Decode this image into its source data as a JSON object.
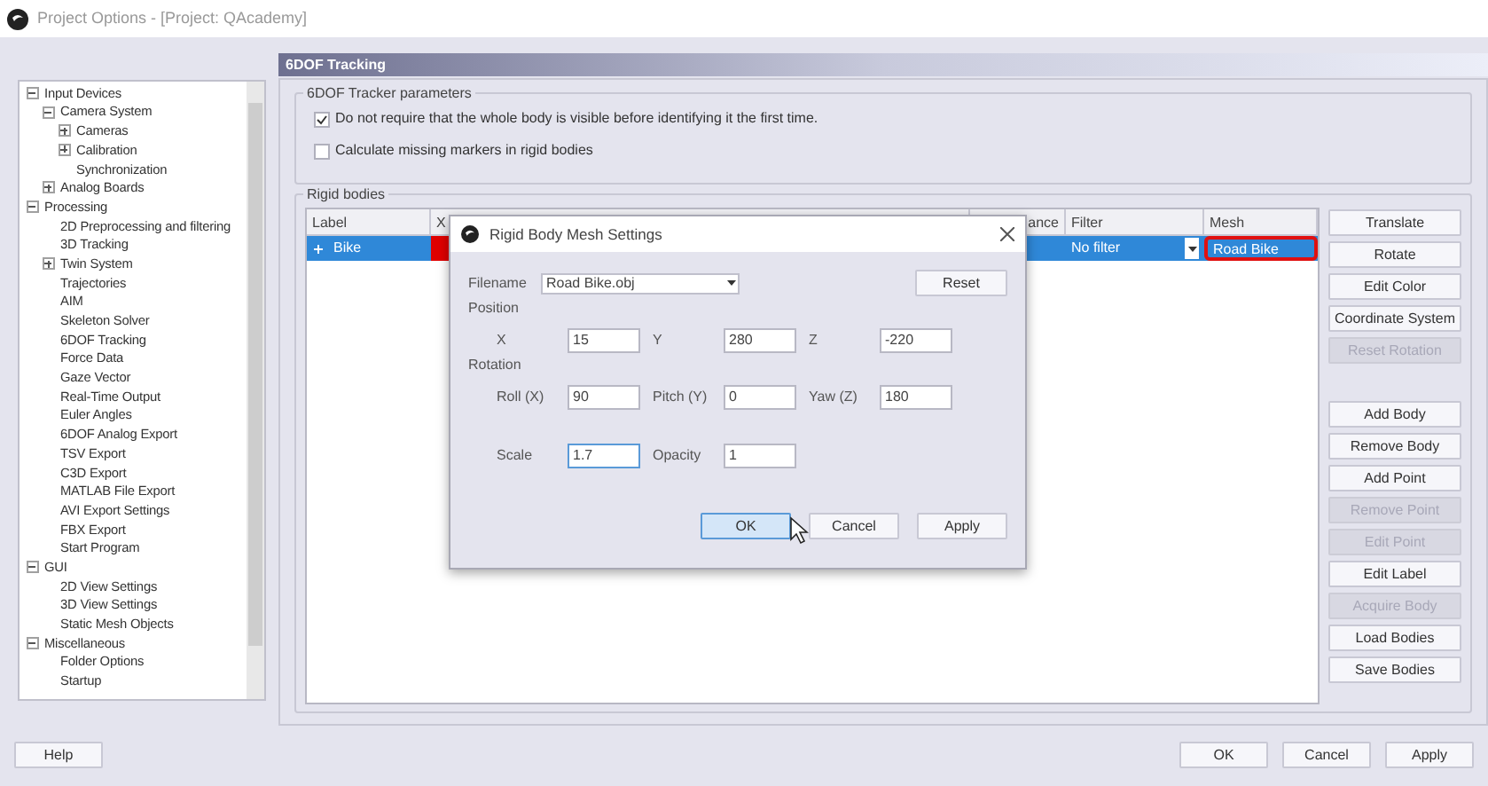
{
  "window": {
    "title": "Project Options - [Project: QAcademy]"
  },
  "tree": [
    {
      "label": "Input Devices",
      "expanded": true,
      "children": [
        {
          "label": "Camera System",
          "expanded": true,
          "children": [
            {
              "label": "Cameras",
              "expanded": false
            },
            {
              "label": "Calibration",
              "expanded": false
            },
            {
              "label": "Synchronization"
            }
          ]
        },
        {
          "label": "Analog Boards",
          "expanded": false
        }
      ]
    },
    {
      "label": "Processing",
      "expanded": true,
      "children": [
        {
          "label": "2D Preprocessing and filtering"
        },
        {
          "label": "3D Tracking"
        },
        {
          "label": "Twin System",
          "expanded": false
        },
        {
          "label": "Trajectories"
        },
        {
          "label": "AIM"
        },
        {
          "label": "Skeleton Solver"
        },
        {
          "label": "6DOF Tracking"
        },
        {
          "label": "Force Data"
        },
        {
          "label": "Gaze Vector"
        },
        {
          "label": "Real-Time Output"
        },
        {
          "label": "Euler Angles"
        },
        {
          "label": "6DOF Analog Export"
        },
        {
          "label": "TSV Export"
        },
        {
          "label": "C3D Export"
        },
        {
          "label": "MATLAB File Export"
        },
        {
          "label": "AVI Export Settings"
        },
        {
          "label": "FBX Export"
        },
        {
          "label": "Start Program"
        }
      ]
    },
    {
      "label": "GUI",
      "expanded": true,
      "children": [
        {
          "label": "2D View Settings"
        },
        {
          "label": "3D View Settings"
        },
        {
          "label": "Static Mesh Objects"
        }
      ]
    },
    {
      "label": "Miscellaneous",
      "expanded": true,
      "children": [
        {
          "label": "Folder Options"
        },
        {
          "label": "Startup"
        }
      ]
    }
  ],
  "page_title": "6DOF Tracking",
  "tracker_group": {
    "title": "6DOF Tracker parameters",
    "options": [
      {
        "label": "Do not require that the whole body is visible before identifying it the first time.",
        "checked": true
      },
      {
        "label": "Calculate missing markers in rigid bodies",
        "checked": false
      }
    ]
  },
  "rigid_bodies": {
    "title": "Rigid bodies",
    "columns": [
      "Label",
      "X",
      "ance",
      "Filter",
      "Mesh"
    ],
    "rows": [
      {
        "label": "Bike",
        "color": "#e00000",
        "filter": "No filter",
        "mesh": "Road Bike",
        "selected": true
      }
    ],
    "button_groups": [
      [
        {
          "label": "Translate",
          "disabled": false
        },
        {
          "label": "Rotate",
          "disabled": false
        },
        {
          "label": "Edit Color",
          "disabled": false
        },
        {
          "label": "Coordinate System",
          "disabled": false
        },
        {
          "label": "Reset Rotation",
          "disabled": true
        }
      ],
      [
        {
          "label": "Add Body",
          "disabled": false
        },
        {
          "label": "Remove Body",
          "disabled": false
        },
        {
          "label": "Add Point",
          "disabled": false
        },
        {
          "label": "Remove Point",
          "disabled": true
        },
        {
          "label": "Edit Point",
          "disabled": true
        },
        {
          "label": "Edit Label",
          "disabled": false
        },
        {
          "label": "Acquire Body",
          "disabled": true
        },
        {
          "label": "Load Bodies",
          "disabled": false
        },
        {
          "label": "Save Bodies",
          "disabled": false
        }
      ]
    ]
  },
  "dialog": {
    "title": "Rigid Body Mesh Settings",
    "filename_label": "Filename",
    "filename": "Road Bike.obj",
    "reset": "Reset",
    "position_label": "Position",
    "position": [
      {
        "label": "X",
        "value": "15"
      },
      {
        "label": "Y",
        "value": "280"
      },
      {
        "label": "Z",
        "value": "-220"
      }
    ],
    "rotation_label": "Rotation",
    "rotation": [
      {
        "label": "Roll (X)",
        "value": "90"
      },
      {
        "label": "Pitch (Y)",
        "value": "0"
      },
      {
        "label": "Yaw (Z)",
        "value": "180"
      }
    ],
    "extra": [
      {
        "label": "Scale",
        "value": "1.7",
        "focused": true
      },
      {
        "label": "Opacity",
        "value": "1",
        "focused": false
      }
    ],
    "buttons": [
      {
        "label": "OK",
        "selected": true
      },
      {
        "label": "Cancel",
        "selected": false
      },
      {
        "label": "Apply",
        "selected": false
      }
    ]
  },
  "help": "Help",
  "footer_buttons": [
    {
      "label": "OK",
      "disabled": false
    },
    {
      "label": "Cancel",
      "disabled": false
    },
    {
      "label": "Apply",
      "disabled": false
    }
  ]
}
